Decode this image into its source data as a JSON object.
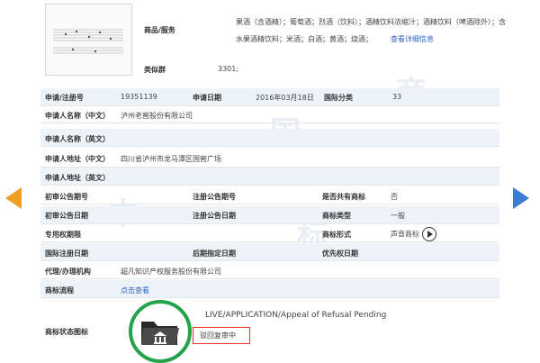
{
  "goods_services": {
    "label": "商品/服务",
    "text_line1": "果酒（含酒精）；葡萄酒；烈酒（饮料）；酒精饮料浓缩汁；酒精饮料（啤酒除外）；含",
    "text_line2": "水果酒精饮料；米酒；白酒；黄酒；烧酒；",
    "details_link": "查看详细信息"
  },
  "similar_group": {
    "label": "类似群",
    "value": "3301;"
  },
  "rows": {
    "application_no": {
      "label": "申请/注册号",
      "value": "19351139"
    },
    "application_date": {
      "label": "申请日期",
      "value": "2016年03月18日"
    },
    "intl_class": {
      "label": "国际分类",
      "value": "33"
    },
    "applicant_cn": {
      "label": "申请人名称（中文）",
      "value": "泸州老窖股份有限公司"
    },
    "applicant_en": {
      "label": "申请人名称（英文）",
      "value": ""
    },
    "address_cn": {
      "label": "申请人地址（中文）",
      "value": "四川省泸州市龙马潭区国窖广场"
    },
    "address_en": {
      "label": "申请人地址（英文）",
      "value": ""
    },
    "prelim_pub_no": {
      "label": "初审公告期号",
      "value": ""
    },
    "reg_pub_no": {
      "label": "注册公告期号",
      "value": ""
    },
    "shared": {
      "label": "是否共有商标",
      "value": "否"
    },
    "prelim_pub_date": {
      "label": "初审公告日期",
      "value": ""
    },
    "reg_pub_date": {
      "label": "注册公告日期",
      "value": ""
    },
    "mark_type": {
      "label": "商标类型",
      "value": "一般"
    },
    "exclusive_period": {
      "label": "专用权期限",
      "value": ""
    },
    "mark_form": {
      "label": "商标形式",
      "value": "声音商标"
    },
    "intl_reg_date": {
      "label": "国际注册日期",
      "value": ""
    },
    "later_designation": {
      "label": "后期指定日期",
      "value": ""
    },
    "priority_date": {
      "label": "优先权日期",
      "value": ""
    },
    "agent": {
      "label": "代理/办理机构",
      "value": "超凡知识产权服务股份有限公司"
    },
    "process": {
      "label": "商标流程",
      "value": "点击查看"
    },
    "status_icon": {
      "label": "商标状态图标"
    }
  },
  "status": {
    "english": "LIVE/APPLICATION/Appeal of Refusal Pending",
    "chinese": "驳回复审中",
    "circle_color": "#24a24a",
    "box_color": "#e33333"
  },
  "colors": {
    "left_arrow": "#f0a020",
    "right_arrow": "#3b7bd4",
    "link": "#2f62c8"
  },
  "icons": {
    "left": "prev-arrow-icon",
    "right": "next-arrow-icon",
    "folder": "folder-court-icon",
    "play": "play-icon"
  },
  "watermark": [
    "中",
    "国",
    "商",
    "标"
  ]
}
